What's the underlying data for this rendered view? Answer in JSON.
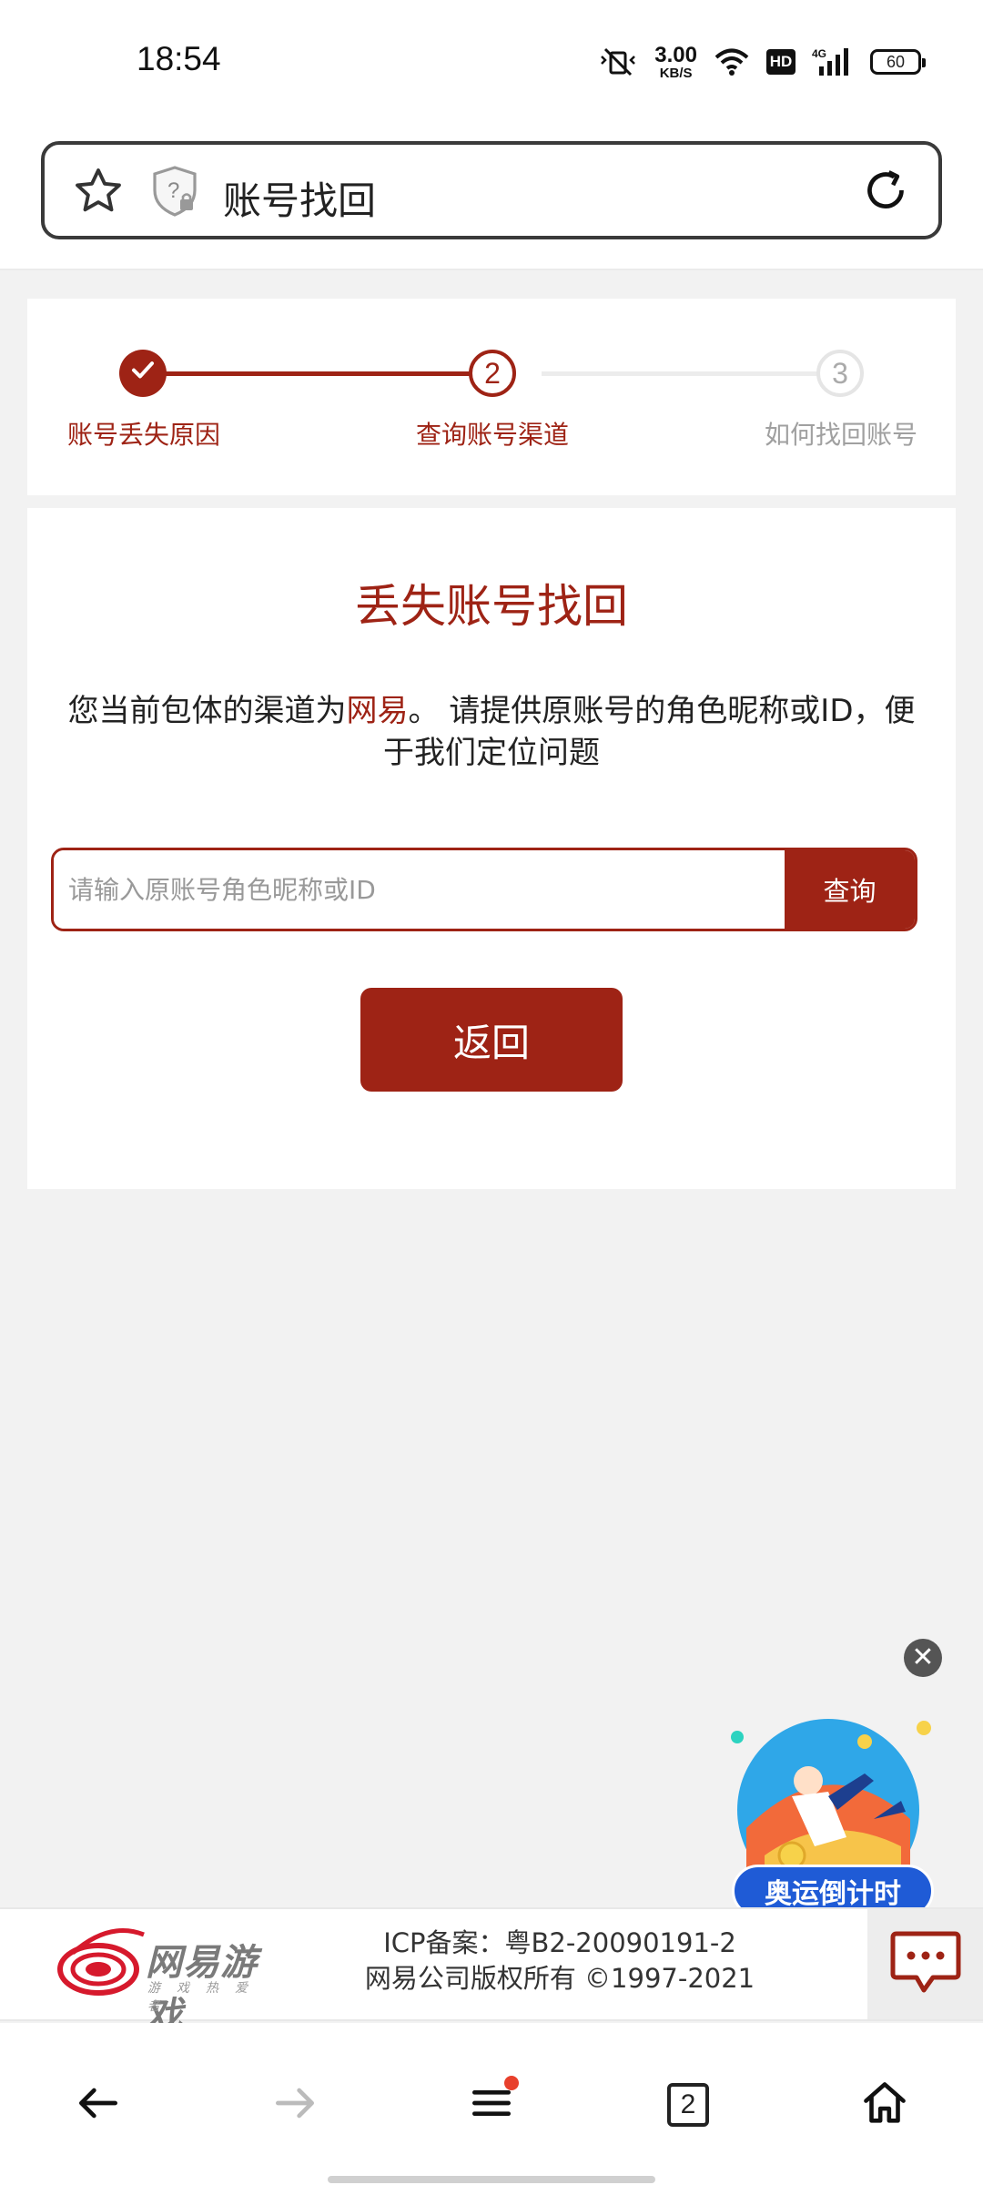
{
  "status_bar": {
    "time": "18:54",
    "net_speed_value": "3.00",
    "net_speed_unit": "KB/S",
    "hd_label": "HD",
    "network_type": "4G",
    "battery": "60",
    "icons": [
      "mute-vibrate-icon",
      "wifi-icon",
      "signal-icon",
      "battery-icon"
    ]
  },
  "address_bar": {
    "title": "账号找回",
    "icons": [
      "star-icon",
      "shield-question-icon",
      "reload-icon"
    ]
  },
  "steps": [
    {
      "number": "1",
      "label": "账号丢失原因",
      "state": "done"
    },
    {
      "number": "2",
      "label": "查询账号渠道",
      "state": "current"
    },
    {
      "number": "3",
      "label": "如何找回账号",
      "state": "pending"
    }
  ],
  "main": {
    "title": "丢失账号找回",
    "desc_prefix": "您当前包体的渠道为",
    "desc_channel": "网易",
    "desc_suffix": "。 请提供原账号的角色昵称或ID，便于我们定位问题",
    "search_placeholder": "请输入原账号角色昵称或ID",
    "search_value": "",
    "search_button": "查询",
    "back_button": "返回"
  },
  "promo": {
    "label": "奥运倒计时",
    "close_symbol": "✕"
  },
  "footer": {
    "logo_text": "网易游戏",
    "logo_slogan": "游戏热爱者",
    "icp": "ICP备案：粤B2-20090191-2",
    "copyright": "网易公司版权所有 ©1997-2021"
  },
  "bottom_nav": {
    "tab_count": "2",
    "items": [
      "back-icon",
      "forward-icon",
      "menu-icon",
      "tabs-icon",
      "home-icon"
    ]
  },
  "colors": {
    "brand": "#9e2315",
    "promo_blue": "#1f5bd6",
    "notification_dot": "#e8402c"
  }
}
